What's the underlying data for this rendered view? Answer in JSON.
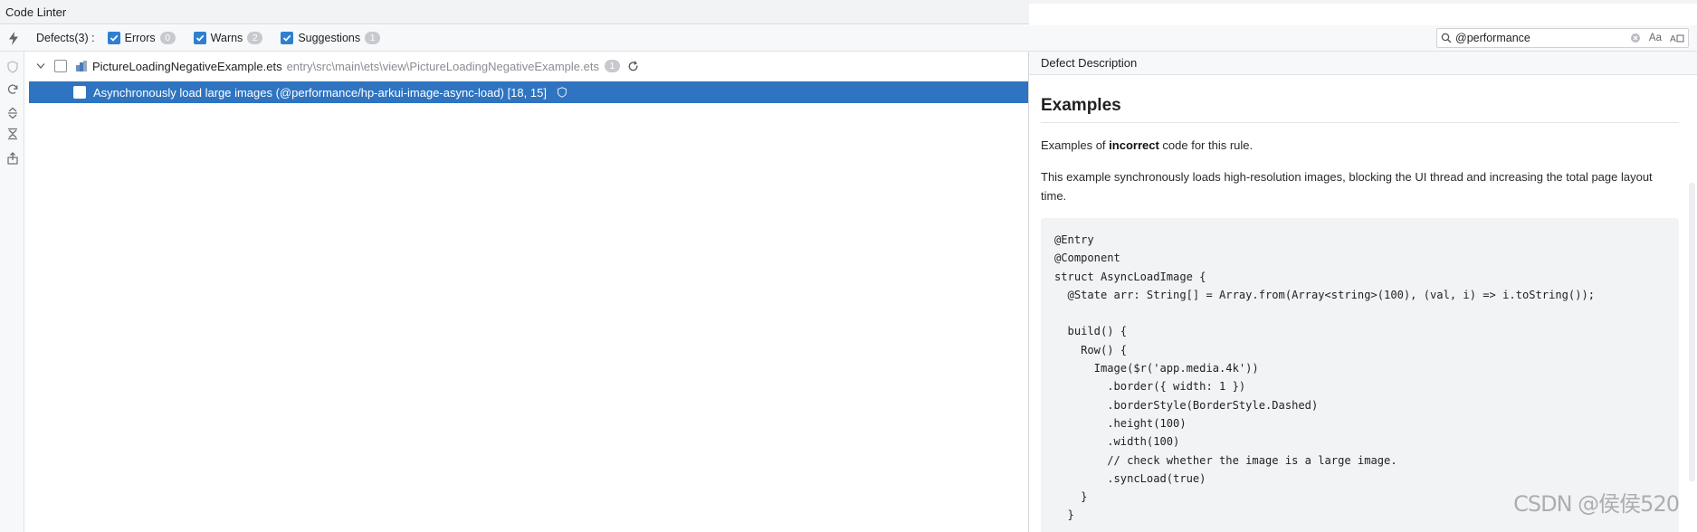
{
  "window": {
    "title": "Code Linter"
  },
  "toolbar": {
    "defects_label": "Defects(3)",
    "defects_sep": ":",
    "filters": [
      {
        "label": "Errors",
        "count": "0",
        "checked": true
      },
      {
        "label": "Warns",
        "count": "2",
        "checked": true
      },
      {
        "label": "Suggestions",
        "count": "1",
        "checked": true
      }
    ],
    "search": {
      "value": "@performance",
      "match_case_label": "Aa"
    }
  },
  "tree": {
    "file": {
      "name": "PictureLoadingNegativeExample.ets",
      "path": "entry\\src\\main\\ets\\view\\PictureLoadingNegativeExample.ets",
      "count": "1"
    },
    "defect": {
      "message": "Asynchronously load large images (@performance/hp-arkui-image-async-load) [18, 15]"
    }
  },
  "description": {
    "header": "Defect Description",
    "section_title": "Examples",
    "intro_prefix": "Examples of ",
    "intro_bold": "incorrect",
    "intro_suffix": " code for this rule.",
    "explanation": "This example synchronously loads high-resolution images, blocking the UI thread and increasing the total page layout time.",
    "code_lines": [
      "@Entry",
      "@Component",
      "struct AsyncLoadImage {",
      "  @State arr: String[] = Array.from(Array<string>(100), (val, i) => i.toString());",
      "",
      "  build() {",
      "    Row() {",
      "      Image($r('app.media.4k'))",
      "        .border({ width: 1 })",
      "        .borderStyle(BorderStyle.Dashed)",
      "        .height(100)",
      "        .width(100)",
      "        // check whether the image is a large image.",
      "        .syncLoad(true)",
      "    }",
      "  }"
    ]
  },
  "watermark": "CSDN @侯侯520"
}
